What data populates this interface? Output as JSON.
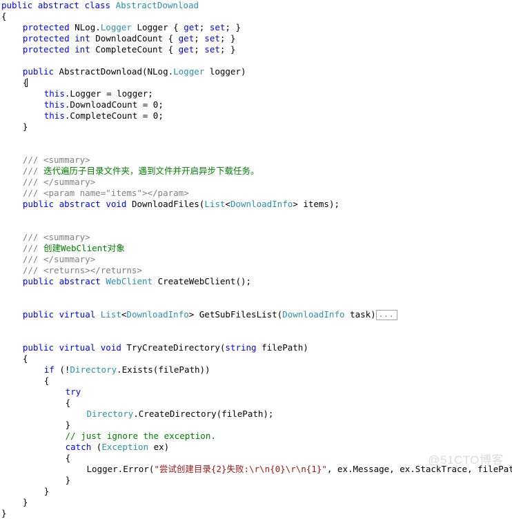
{
  "editor": {
    "language": "csharp",
    "colors": {
      "background": "#ffffff",
      "plain": "#000000",
      "keyword": "#0000ff",
      "type": "#2b91af",
      "string": "#a31515",
      "comment": "#008000",
      "doc_comment": "#808080",
      "collapsed_box_border": "#a0a0a0",
      "watermark": "#dcdcdc"
    },
    "collapsed_region_label": "...",
    "lines": [
      {
        "n": 1,
        "indent": 0,
        "tokens": [
          {
            "t": "kw",
            "v": "public"
          },
          {
            "t": "pln",
            "v": " "
          },
          {
            "t": "kw",
            "v": "abstract"
          },
          {
            "t": "pln",
            "v": " "
          },
          {
            "t": "kw",
            "v": "class"
          },
          {
            "t": "pln",
            "v": " "
          },
          {
            "t": "typ",
            "v": "AbstractDownload"
          }
        ]
      },
      {
        "n": 2,
        "indent": 0,
        "tokens": [
          {
            "t": "pln",
            "v": "{"
          }
        ]
      },
      {
        "n": 3,
        "indent": 4,
        "tokens": [
          {
            "t": "kw",
            "v": "protected"
          },
          {
            "t": "pln",
            "v": " NLog."
          },
          {
            "t": "typ",
            "v": "Logger"
          },
          {
            "t": "pln",
            "v": " Logger { "
          },
          {
            "t": "kw",
            "v": "get"
          },
          {
            "t": "pln",
            "v": "; "
          },
          {
            "t": "kw",
            "v": "set"
          },
          {
            "t": "pln",
            "v": "; }"
          }
        ]
      },
      {
        "n": 4,
        "indent": 4,
        "tokens": [
          {
            "t": "kw",
            "v": "protected"
          },
          {
            "t": "pln",
            "v": " "
          },
          {
            "t": "kw",
            "v": "int"
          },
          {
            "t": "pln",
            "v": " DownloadCount { "
          },
          {
            "t": "kw",
            "v": "get"
          },
          {
            "t": "pln",
            "v": "; "
          },
          {
            "t": "kw",
            "v": "set"
          },
          {
            "t": "pln",
            "v": "; }"
          }
        ]
      },
      {
        "n": 5,
        "indent": 4,
        "tokens": [
          {
            "t": "kw",
            "v": "protected"
          },
          {
            "t": "pln",
            "v": " "
          },
          {
            "t": "kw",
            "v": "int"
          },
          {
            "t": "pln",
            "v": " CompleteCount { "
          },
          {
            "t": "kw",
            "v": "get"
          },
          {
            "t": "pln",
            "v": "; "
          },
          {
            "t": "kw",
            "v": "set"
          },
          {
            "t": "pln",
            "v": "; }"
          }
        ]
      },
      {
        "n": 6,
        "indent": 0,
        "tokens": []
      },
      {
        "n": 7,
        "indent": 4,
        "tokens": [
          {
            "t": "kw",
            "v": "public"
          },
          {
            "t": "pln",
            "v": " AbstractDownload(NLog."
          },
          {
            "t": "typ",
            "v": "Logger"
          },
          {
            "t": "pln",
            "v": " logger)"
          }
        ]
      },
      {
        "n": 8,
        "indent": 4,
        "caret": true,
        "tokens": [
          {
            "t": "pln",
            "v": "{"
          }
        ]
      },
      {
        "n": 9,
        "indent": 8,
        "tokens": [
          {
            "t": "kw",
            "v": "this"
          },
          {
            "t": "pln",
            "v": ".Logger = logger;"
          }
        ]
      },
      {
        "n": 10,
        "indent": 8,
        "tokens": [
          {
            "t": "kw",
            "v": "this"
          },
          {
            "t": "pln",
            "v": ".DownloadCount = 0;"
          }
        ]
      },
      {
        "n": 11,
        "indent": 8,
        "tokens": [
          {
            "t": "kw",
            "v": "this"
          },
          {
            "t": "pln",
            "v": ".CompleteCount = 0;"
          }
        ]
      },
      {
        "n": 12,
        "indent": 4,
        "tokens": [
          {
            "t": "pln",
            "v": "}"
          }
        ]
      },
      {
        "n": 13,
        "indent": 0,
        "tokens": []
      },
      {
        "n": 14,
        "indent": 0,
        "tokens": []
      },
      {
        "n": 15,
        "indent": 4,
        "tokens": [
          {
            "t": "doc",
            "v": "/// <summary>"
          }
        ]
      },
      {
        "n": 16,
        "indent": 4,
        "tokens": [
          {
            "t": "doc",
            "v": "/// "
          },
          {
            "t": "cmt",
            "v": "迭代遍历子目录文件夹，遇到文件并开启异步下载任务。"
          }
        ]
      },
      {
        "n": 17,
        "indent": 4,
        "tokens": [
          {
            "t": "doc",
            "v": "/// </summary>"
          }
        ]
      },
      {
        "n": 18,
        "indent": 4,
        "tokens": [
          {
            "t": "doc",
            "v": "/// <param name=\"items\"></param>"
          }
        ]
      },
      {
        "n": 19,
        "indent": 4,
        "tokens": [
          {
            "t": "kw",
            "v": "public"
          },
          {
            "t": "pln",
            "v": " "
          },
          {
            "t": "kw",
            "v": "abstract"
          },
          {
            "t": "pln",
            "v": " "
          },
          {
            "t": "kw",
            "v": "void"
          },
          {
            "t": "pln",
            "v": " DownloadFiles("
          },
          {
            "t": "typ",
            "v": "List"
          },
          {
            "t": "pln",
            "v": "<"
          },
          {
            "t": "typ",
            "v": "DownloadInfo"
          },
          {
            "t": "pln",
            "v": "> items);"
          }
        ]
      },
      {
        "n": 20,
        "indent": 0,
        "tokens": []
      },
      {
        "n": 21,
        "indent": 0,
        "tokens": []
      },
      {
        "n": 22,
        "indent": 4,
        "tokens": [
          {
            "t": "doc",
            "v": "/// <summary>"
          }
        ]
      },
      {
        "n": 23,
        "indent": 4,
        "tokens": [
          {
            "t": "doc",
            "v": "/// "
          },
          {
            "t": "cmt",
            "v": "创建WebClient对象"
          }
        ]
      },
      {
        "n": 24,
        "indent": 4,
        "tokens": [
          {
            "t": "doc",
            "v": "/// </summary>"
          }
        ]
      },
      {
        "n": 25,
        "indent": 4,
        "tokens": [
          {
            "t": "doc",
            "v": "/// <returns></returns>"
          }
        ]
      },
      {
        "n": 26,
        "indent": 4,
        "tokens": [
          {
            "t": "kw",
            "v": "public"
          },
          {
            "t": "pln",
            "v": " "
          },
          {
            "t": "kw",
            "v": "abstract"
          },
          {
            "t": "pln",
            "v": " "
          },
          {
            "t": "typ",
            "v": "WebClient"
          },
          {
            "t": "pln",
            "v": " CreateWebClient();"
          }
        ]
      },
      {
        "n": 27,
        "indent": 0,
        "tokens": []
      },
      {
        "n": 28,
        "indent": 0,
        "tokens": []
      },
      {
        "n": 29,
        "indent": 4,
        "collapsed": true,
        "tokens": [
          {
            "t": "kw",
            "v": "public"
          },
          {
            "t": "pln",
            "v": " "
          },
          {
            "t": "kw",
            "v": "virtual"
          },
          {
            "t": "pln",
            "v": " "
          },
          {
            "t": "typ",
            "v": "List"
          },
          {
            "t": "pln",
            "v": "<"
          },
          {
            "t": "typ",
            "v": "DownloadInfo"
          },
          {
            "t": "pln",
            "v": "> GetSubFilesList("
          },
          {
            "t": "typ",
            "v": "DownloadInfo"
          },
          {
            "t": "pln",
            "v": " task)"
          }
        ]
      },
      {
        "n": 30,
        "indent": 0,
        "tokens": []
      },
      {
        "n": 31,
        "indent": 0,
        "tokens": []
      },
      {
        "n": 32,
        "indent": 4,
        "tokens": [
          {
            "t": "kw",
            "v": "public"
          },
          {
            "t": "pln",
            "v": " "
          },
          {
            "t": "kw",
            "v": "virtual"
          },
          {
            "t": "pln",
            "v": " "
          },
          {
            "t": "kw",
            "v": "void"
          },
          {
            "t": "pln",
            "v": " TryCreateDirectory("
          },
          {
            "t": "kw",
            "v": "string"
          },
          {
            "t": "pln",
            "v": " filePath)"
          }
        ]
      },
      {
        "n": 33,
        "indent": 4,
        "tokens": [
          {
            "t": "pln",
            "v": "{"
          }
        ]
      },
      {
        "n": 34,
        "indent": 8,
        "tokens": [
          {
            "t": "kw",
            "v": "if"
          },
          {
            "t": "pln",
            "v": " (!"
          },
          {
            "t": "typ",
            "v": "Directory"
          },
          {
            "t": "pln",
            "v": ".Exists(filePath))"
          }
        ]
      },
      {
        "n": 35,
        "indent": 8,
        "tokens": [
          {
            "t": "pln",
            "v": "{"
          }
        ]
      },
      {
        "n": 36,
        "indent": 12,
        "tokens": [
          {
            "t": "kw",
            "v": "try"
          }
        ]
      },
      {
        "n": 37,
        "indent": 12,
        "tokens": [
          {
            "t": "pln",
            "v": "{"
          }
        ]
      },
      {
        "n": 38,
        "indent": 16,
        "tokens": [
          {
            "t": "typ",
            "v": "Directory"
          },
          {
            "t": "pln",
            "v": ".CreateDirectory(filePath);"
          }
        ]
      },
      {
        "n": 39,
        "indent": 12,
        "tokens": [
          {
            "t": "pln",
            "v": "}"
          }
        ]
      },
      {
        "n": 40,
        "indent": 12,
        "tokens": [
          {
            "t": "cmt",
            "v": "// just ignore the exception."
          }
        ]
      },
      {
        "n": 41,
        "indent": 12,
        "tokens": [
          {
            "t": "kw",
            "v": "catch"
          },
          {
            "t": "pln",
            "v": " ("
          },
          {
            "t": "typ",
            "v": "Exception"
          },
          {
            "t": "pln",
            "v": " ex)"
          }
        ]
      },
      {
        "n": 42,
        "indent": 12,
        "tokens": [
          {
            "t": "pln",
            "v": "{"
          }
        ]
      },
      {
        "n": 43,
        "indent": 16,
        "tokens": [
          {
            "t": "pln",
            "v": "Logger.Error("
          },
          {
            "t": "str",
            "v": "\"尝试创建目录{2}失败:\\r\\n{0}\\r\\n{1}\""
          },
          {
            "t": "pln",
            "v": ", ex.Message, ex.StackTrace, filePath);"
          }
        ]
      },
      {
        "n": 44,
        "indent": 12,
        "tokens": [
          {
            "t": "pln",
            "v": "}"
          }
        ]
      },
      {
        "n": 45,
        "indent": 8,
        "tokens": [
          {
            "t": "pln",
            "v": "}"
          }
        ]
      },
      {
        "n": 46,
        "indent": 4,
        "tokens": [
          {
            "t": "pln",
            "v": "}"
          }
        ]
      },
      {
        "n": 47,
        "indent": 0,
        "tokens": [
          {
            "t": "pln",
            "v": "}"
          }
        ]
      }
    ]
  },
  "watermark": {
    "text": "@51CTO博客"
  }
}
